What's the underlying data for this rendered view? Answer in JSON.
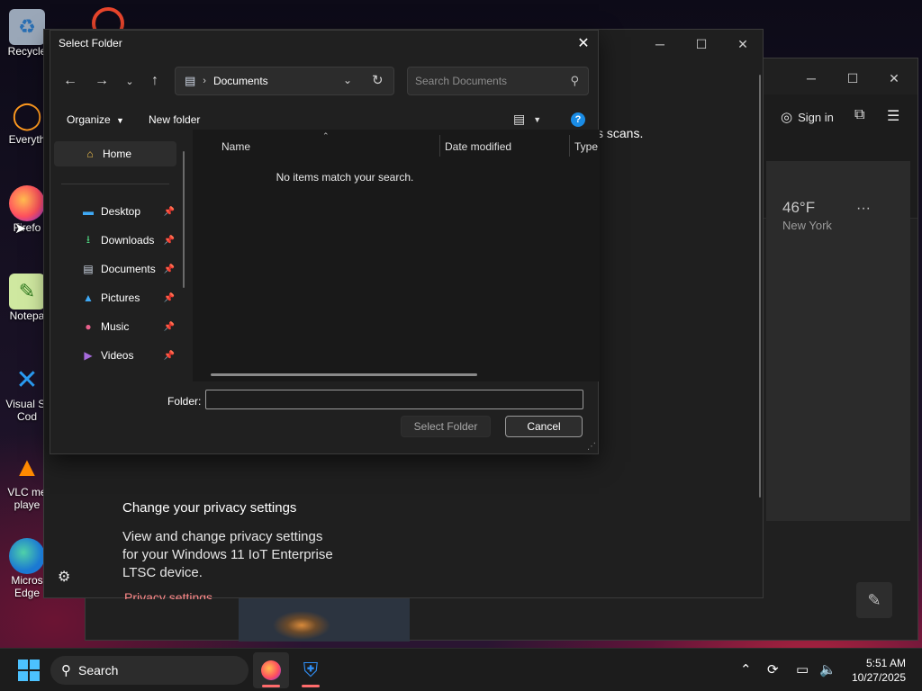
{
  "dialog": {
    "title": "Select Folder",
    "breadcrumb": "Documents",
    "search_placeholder": "Search Documents",
    "organize_label": "Organize",
    "new_folder_label": "New folder",
    "columns": [
      "Name",
      "Date modified",
      "Type"
    ],
    "empty_message": "No items match your search.",
    "folder_label": "Folder:",
    "folder_value": "",
    "select_button": "Select Folder",
    "cancel_button": "Cancel"
  },
  "sidebar": {
    "items": [
      {
        "label": "Home",
        "icon": "home-icon"
      },
      {
        "label": "Desktop",
        "icon": "desktop-icon"
      },
      {
        "label": "Downloads",
        "icon": "downloads-icon"
      },
      {
        "label": "Documents",
        "icon": "documents-icon"
      },
      {
        "label": "Pictures",
        "icon": "pictures-icon"
      },
      {
        "label": "Music",
        "icon": "music-icon"
      },
      {
        "label": "Videos",
        "icon": "videos-icon"
      }
    ]
  },
  "background_app": {
    "scan_fragment": "s scans.",
    "privacy_heading": "Change your privacy settings",
    "privacy_body_1": "View and change privacy settings",
    "privacy_body_2": "for your Windows 11 IoT Enterprise",
    "privacy_body_3": "LTSC device.",
    "privacy_link": "Privacy settings"
  },
  "browser_window": {
    "sign_in": "Sign in",
    "temperature": "46°F",
    "location": "New York"
  },
  "desktop_icons": [
    {
      "label": "Recycle"
    },
    {
      "label": "Everyth"
    },
    {
      "label": "Firefo"
    },
    {
      "label": "Notepa"
    },
    {
      "label": "Visual St",
      "label2": "Cod"
    },
    {
      "label": "VLC me",
      "label2": "playe"
    },
    {
      "label": "Micros",
      "label2": "Edge"
    }
  ],
  "taskbar": {
    "search_label": "Search",
    "time": "5:51 AM",
    "date": "10/27/2025"
  },
  "colors": {
    "accent": "#4cc2ff",
    "help": "#1a8ce6",
    "link": "#ff8a8a"
  }
}
